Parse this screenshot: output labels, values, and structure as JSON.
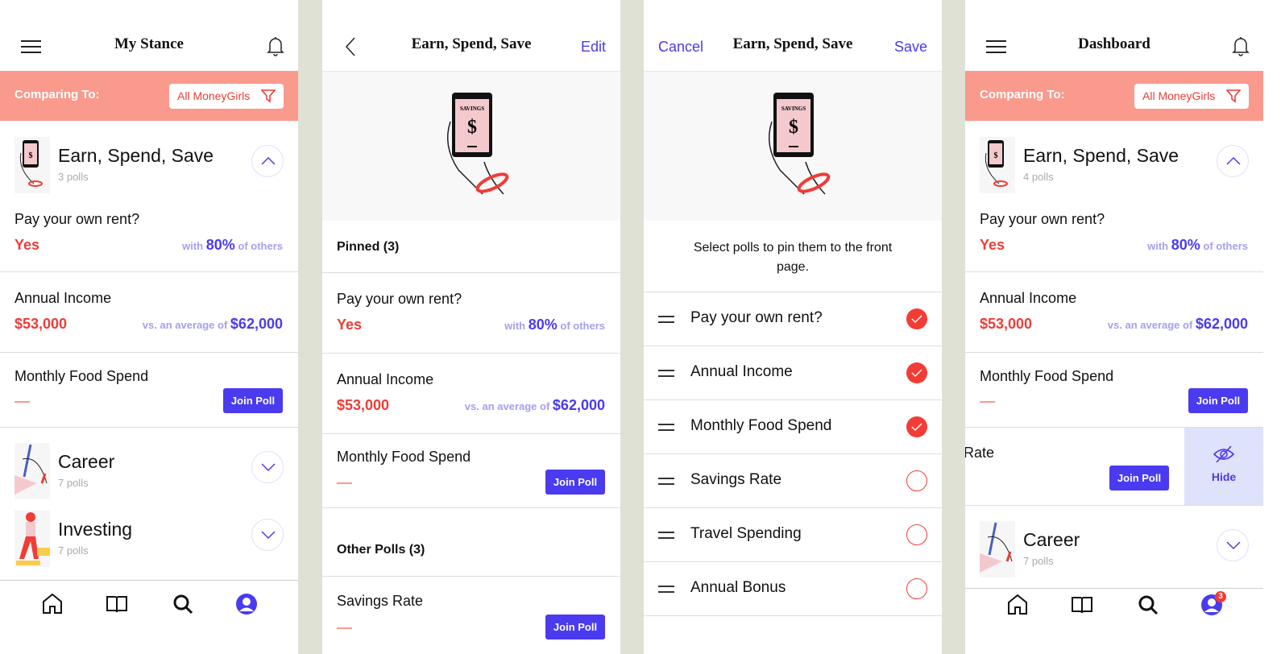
{
  "colors": {
    "accent": "#4a3af0",
    "red": "#ef3c37",
    "banner": "#f99a8d",
    "gap": "#e0e1d5"
  },
  "screen1": {
    "title": "My Stance",
    "comparing_label": "Comparing To:",
    "filter_value": "All MoneyGirls",
    "categories": [
      {
        "name": "Earn, Spend, Save",
        "count": "3 polls",
        "expanded": true
      },
      {
        "name": "Career",
        "count": "7 polls",
        "expanded": false
      },
      {
        "name": "Investing",
        "count": "7 polls",
        "expanded": false
      }
    ],
    "polls": [
      {
        "question": "Pay your own rent?",
        "answer": "Yes",
        "cmp_pre": "with",
        "cmp_val": "80%",
        "cmp_post": "of others"
      },
      {
        "question": "Annual Income",
        "answer": "$53,000",
        "cmp_pre": "vs. an average of",
        "cmp_val": "$62,000"
      },
      {
        "question": "Monthly Food Spend",
        "answer": "—",
        "button": "Join Poll"
      }
    ],
    "tabs": [
      "home",
      "library",
      "search",
      "profile"
    ]
  },
  "screen2": {
    "back": "back",
    "title": "Earn, Spend, Save",
    "edit": "Edit",
    "hero_text": "SAVINGS",
    "pinned": "Pinned (3)",
    "other": "Other Polls (3)",
    "polls": [
      {
        "question": "Pay your own rent?",
        "answer": "Yes",
        "cmp_pre": "with",
        "cmp_val": "80%",
        "cmp_post": "of others"
      },
      {
        "question": "Annual Income",
        "answer": "$53,000",
        "cmp_pre": "vs. an average of",
        "cmp_val": "$62,000"
      },
      {
        "question": "Monthly Food Spend",
        "button": "Join Poll"
      },
      {
        "question": "Savings Rate",
        "button": "Join Poll"
      }
    ]
  },
  "screen3": {
    "cancel": "Cancel",
    "title": "Earn, Spend, Save",
    "save": "Save",
    "hero_text": "SAVINGS",
    "instructions": "Select polls to pin them to the front page.",
    "items": [
      {
        "label": "Pay your own rent?",
        "checked": true
      },
      {
        "label": "Annual Income",
        "checked": true
      },
      {
        "label": "Monthly Food Spend",
        "checked": true
      },
      {
        "label": "Savings Rate",
        "checked": false
      },
      {
        "label": "Travel Spending",
        "checked": false
      },
      {
        "label": "Annual Bonus",
        "checked": false
      }
    ]
  },
  "screen4": {
    "title": "Dashboard",
    "comparing_label": "Comparing To:",
    "filter_value": "All MoneyGirls",
    "categories": [
      {
        "name": "Earn, Spend, Save",
        "count": "4 polls",
        "expanded": true
      },
      {
        "name": "Career",
        "count": "7 polls",
        "expanded": false
      }
    ],
    "polls": [
      {
        "question": "Pay your own rent?",
        "answer": "Yes",
        "cmp_pre": "with",
        "cmp_val": "80%",
        "cmp_post": "of others"
      },
      {
        "question": "Annual Income",
        "answer": "$53,000",
        "cmp_pre": "vs. an average of",
        "cmp_val": "$62,000"
      },
      {
        "question": "Monthly Food Spend",
        "button": "Join Poll"
      },
      {
        "question": "Rate",
        "button": "Join Poll",
        "swipe_action": "Hide"
      }
    ],
    "profile_badge": "3"
  }
}
